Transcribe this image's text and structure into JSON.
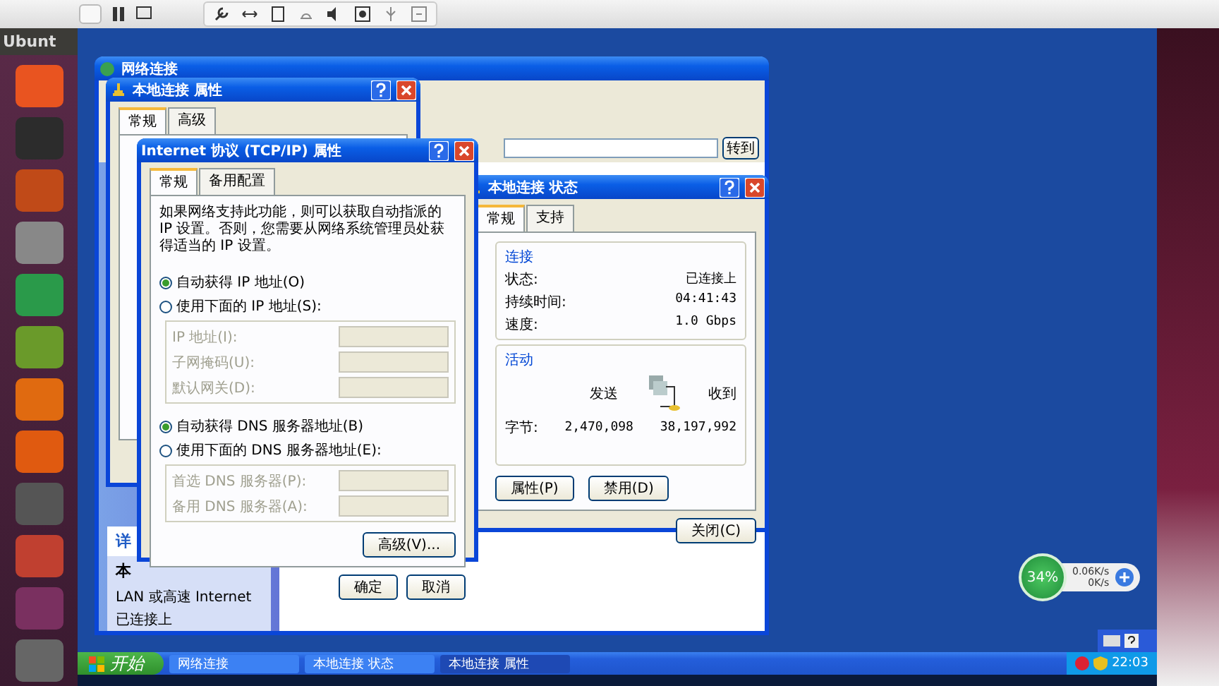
{
  "host": {
    "title": "Ubunt"
  },
  "explorer": {
    "title": "网络连接",
    "go_button": "转到",
    "details": {
      "heading": "详",
      "name": "本",
      "lines": [
        "LAN 或高速 Internet",
        "已连接上"
      ]
    }
  },
  "properties": {
    "title": "本地连接 属性",
    "tabs": [
      {
        "label": "常规",
        "selected": true
      },
      {
        "label": "高级",
        "selected": false
      }
    ]
  },
  "tcpip": {
    "title": "Internet 协议 (TCP/IP) 属性",
    "tabs": [
      {
        "label": "常规",
        "selected": true
      },
      {
        "label": "备用配置",
        "selected": false
      }
    ],
    "description": "如果网络支持此功能，则可以获取自动指派的 IP 设置。否则，您需要从网络系统管理员处获得适当的 IP 设置。",
    "ip_mode": [
      {
        "label": "自动获得 IP 地址(O)",
        "selected": true
      },
      {
        "label": "使用下面的 IP 地址(S):",
        "selected": false
      }
    ],
    "ip_fields": [
      {
        "label": "IP 地址(I):",
        "disabled": true
      },
      {
        "label": "子网掩码(U):",
        "disabled": true
      },
      {
        "label": "默认网关(D):",
        "disabled": true
      }
    ],
    "dns_mode": [
      {
        "label": "自动获得 DNS 服务器地址(B)",
        "selected": true
      },
      {
        "label": "使用下面的 DNS 服务器地址(E):",
        "selected": false
      }
    ],
    "dns_fields": [
      {
        "label": "首选 DNS 服务器(P):",
        "disabled": true
      },
      {
        "label": "备用 DNS 服务器(A):",
        "disabled": true
      }
    ],
    "advanced_button": "高级(V)...",
    "ok_button": "确定",
    "cancel_button": "取消"
  },
  "status": {
    "title": "本地连接 状态",
    "tabs": [
      {
        "label": "常规",
        "selected": true
      },
      {
        "label": "支持",
        "selected": false
      }
    ],
    "connection": {
      "heading": "连接",
      "rows": [
        {
          "label": "状态:",
          "value": "已连接上"
        },
        {
          "label": "持续时间:",
          "value": "04:41:43"
        },
        {
          "label": "速度:",
          "value": "1.0 Gbps"
        }
      ]
    },
    "activity": {
      "heading": "活动",
      "sent": "发送",
      "received": "收到",
      "bytes_label": "字节:",
      "bytes_sent": "2,470,098",
      "bytes_received": "38,197,992"
    },
    "buttons": [
      "属性(P)",
      "禁用(D)"
    ],
    "close_button": "关闭(C)"
  },
  "speed_widget": {
    "percent": "34%",
    "upload": "0.06K/s",
    "download": "0K/s"
  },
  "taskbar": {
    "start": "开始",
    "tasks": [
      {
        "label": "网络连接",
        "selected": false
      },
      {
        "label": "本地连接 状态",
        "selected": false
      },
      {
        "label": "本地连接 属性",
        "selected": true
      }
    ],
    "clock": "22:03"
  }
}
